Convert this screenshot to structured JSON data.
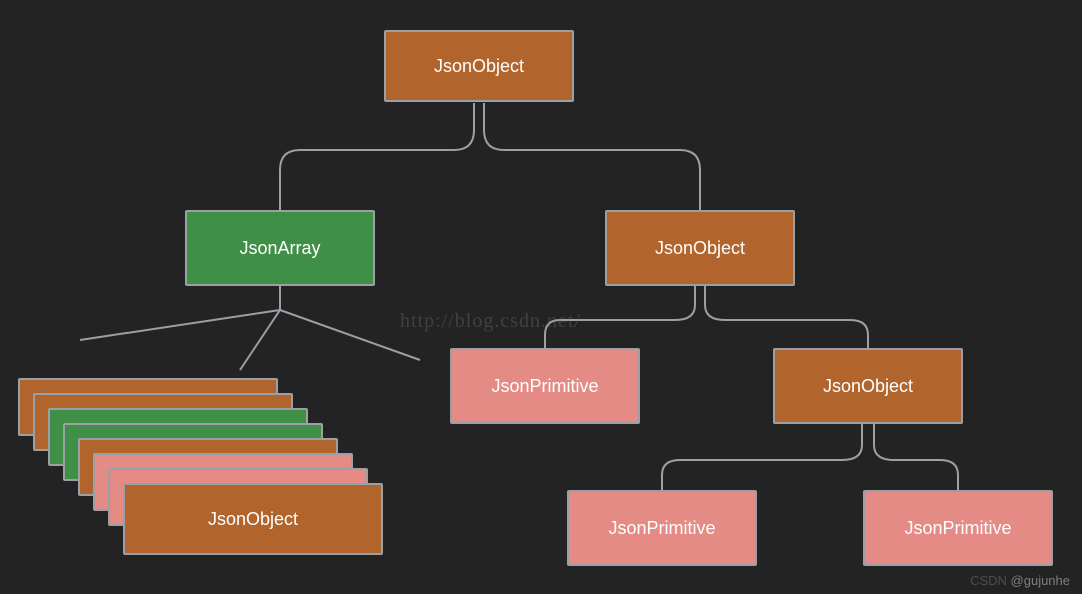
{
  "nodes": {
    "root": {
      "label": "JsonObject"
    },
    "jsonArray": {
      "label": "JsonArray"
    },
    "jsonObject2": {
      "label": "JsonObject"
    },
    "prim1": {
      "label": "JsonPrimitive"
    },
    "jsonObject3": {
      "label": "JsonObject"
    },
    "prim2": {
      "label": "JsonPrimitive"
    },
    "prim3": {
      "label": "JsonPrimitive"
    },
    "stackFront": {
      "label": "JsonObject"
    }
  },
  "watermark": "http://blog.csdn.net/",
  "credit_prefix": "CSDN",
  "credit_user": "@gujunhe",
  "colors": {
    "orange": "#b1652c",
    "green": "#3f8f46",
    "pink": "#e38b84",
    "border": "#9aa0a6",
    "bg": "#232323"
  },
  "chart_data": {
    "type": "tree",
    "title": "",
    "root": {
      "name": "JsonObject",
      "color": "orange",
      "children": [
        {
          "name": "JsonArray",
          "color": "green",
          "children": [
            {
              "name": "JsonObject (stack of mixed items)",
              "color": "orange",
              "stack_colors": [
                "orange",
                "orange",
                "green",
                "green",
                "orange",
                "pink",
                "pink",
                "orange"
              ]
            }
          ]
        },
        {
          "name": "JsonObject",
          "color": "orange",
          "children": [
            {
              "name": "JsonPrimitive",
              "color": "pink"
            },
            {
              "name": "JsonObject",
              "color": "orange",
              "children": [
                {
                  "name": "JsonPrimitive",
                  "color": "pink"
                },
                {
                  "name": "JsonPrimitive",
                  "color": "pink"
                }
              ]
            }
          ]
        }
      ]
    }
  }
}
